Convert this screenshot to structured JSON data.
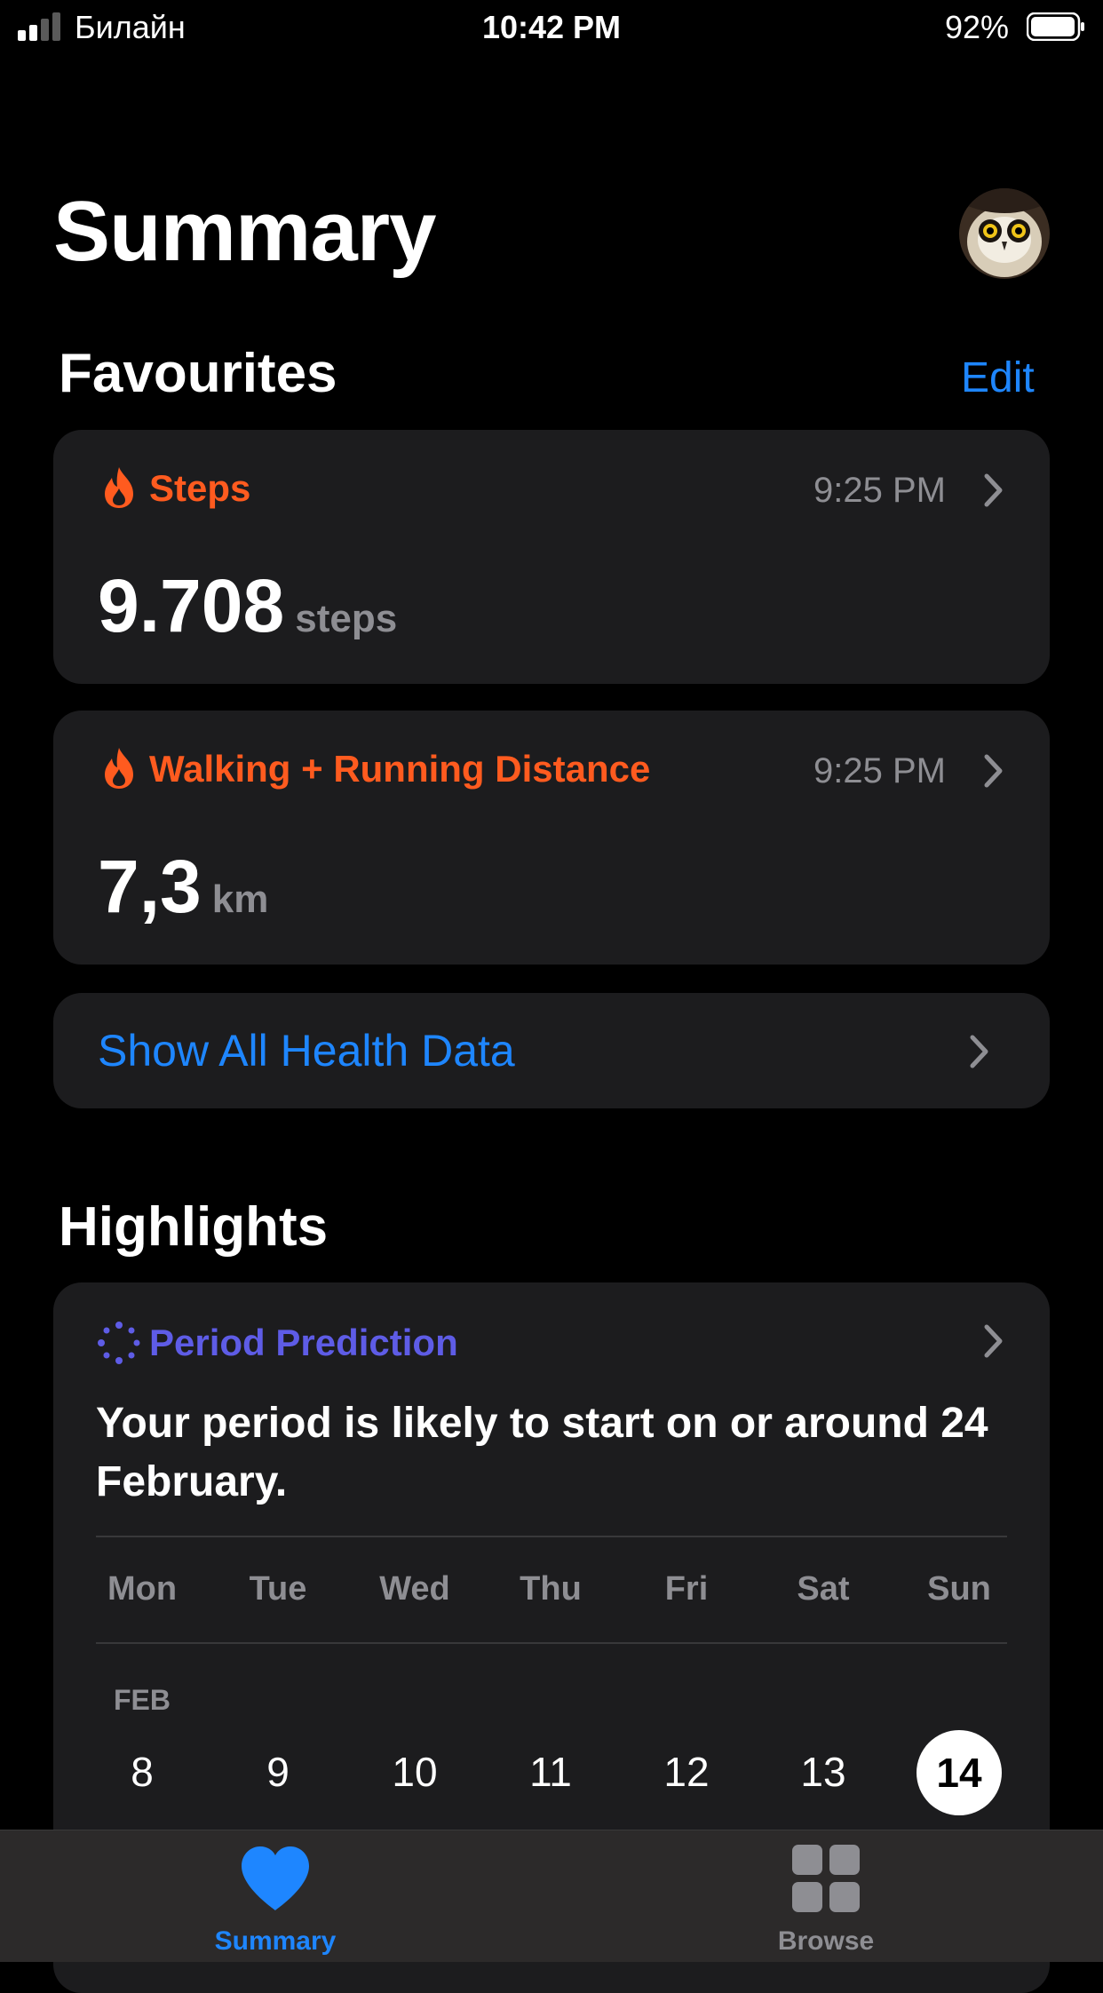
{
  "status_bar": {
    "carrier": "Билайн",
    "time": "10:42 PM",
    "battery": "92%"
  },
  "header": {
    "title": "Summary"
  },
  "favourites": {
    "title": "Favourites",
    "edit_label": "Edit",
    "items": [
      {
        "label": "Steps",
        "time": "9:25 PM",
        "value": "9.708",
        "unit": "steps",
        "icon": "flame-icon"
      },
      {
        "label": "Walking + Running Distance",
        "time": "9:25 PM",
        "value": "7,3",
        "unit": "km",
        "icon": "flame-icon"
      }
    ],
    "show_all_label": "Show All Health Data"
  },
  "highlights": {
    "title": "Highlights",
    "period": {
      "label": "Period Prediction",
      "text": "Your period is likely to start on or around 24 February.",
      "weekdays": [
        "Mon",
        "Tue",
        "Wed",
        "Thu",
        "Fri",
        "Sat",
        "Sun"
      ],
      "month": "FEB",
      "dates": [
        "8",
        "9",
        "10",
        "11",
        "12",
        "13",
        "14"
      ],
      "selected_date": "14"
    }
  },
  "tab_bar": {
    "tabs": [
      {
        "label": "Summary",
        "icon": "heart-icon",
        "active": true
      },
      {
        "label": "Browse",
        "icon": "grid-icon",
        "active": false
      }
    ]
  },
  "colors": {
    "accent": "#1e86ff",
    "activity": "#ff5b1f",
    "cycle": "#5e5ce6"
  }
}
